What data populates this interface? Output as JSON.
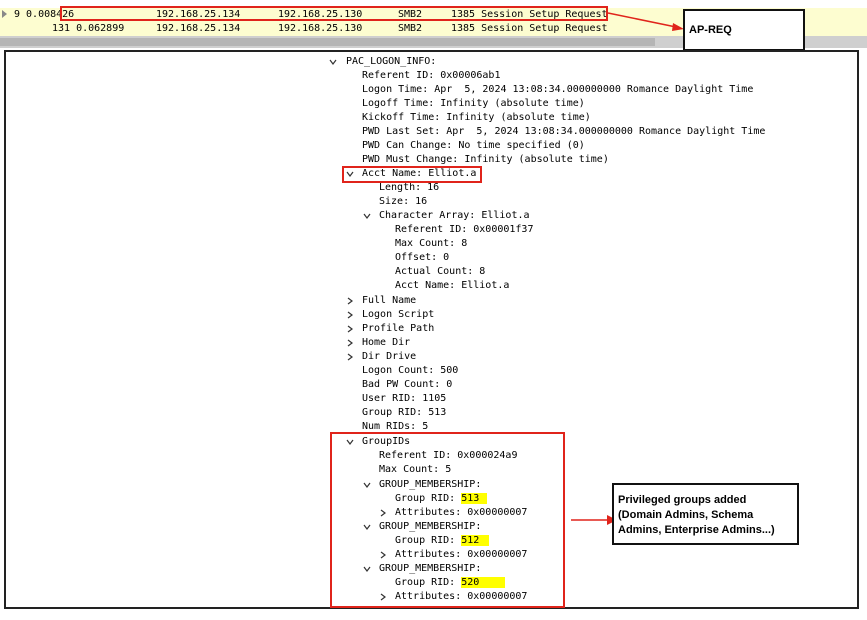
{
  "packet_list": {
    "rows": [
      {
        "no_time": "9 0.008426",
        "src": "192.168.25.134",
        "dst": "192.168.25.130",
        "proto": "SMB2",
        "info": "1385 Session Setup Request"
      },
      {
        "no_time": "131 0.062899",
        "src": "192.168.25.134",
        "dst": "192.168.25.130",
        "proto": "SMB2",
        "info": "1385 Session Setup Request"
      }
    ]
  },
  "tree": {
    "pac_logon_info": "PAC_LOGON_INFO:",
    "referent_id": "Referent ID: 0x00006ab1",
    "logon_time": "Logon Time: Apr  5, 2024 13:08:34.000000000 Romance Daylight Time",
    "logoff_time": "Logoff Time: Infinity (absolute time)",
    "kickoff_time": "Kickoff Time: Infinity (absolute time)",
    "pwd_last_set": "PWD Last Set: Apr  5, 2024 13:08:34.000000000 Romance Daylight Time",
    "pwd_can_change": "PWD Can Change: No time specified (0)",
    "pwd_must_change": "PWD Must Change: Infinity (absolute time)",
    "acct_name": "Acct Name: Elliot.a",
    "length": "Length: 16",
    "size": "Size: 16",
    "char_array": "Character Array: Elliot.a",
    "ca_referent_id": "Referent ID: 0x00001f37",
    "max_count": "Max Count: 8",
    "offset": "Offset: 0",
    "actual_count": "Actual Count: 8",
    "ca_acct_name": "Acct Name: Elliot.a",
    "full_name": "Full Name",
    "logon_script": "Logon Script",
    "profile_path": "Profile Path",
    "home_dir": "Home Dir",
    "dir_drive": "Dir Drive",
    "logon_count": "Logon Count: 500",
    "bad_pw_count": "Bad PW Count: 0",
    "user_rid": "User RID: 1105",
    "group_rid": "Group RID: 513",
    "num_rids": "Num RIDs: 5",
    "group_ids": "GroupIDs",
    "gid_referent_id": "Referent ID: 0x000024a9",
    "gid_max_count": "Max Count: 5",
    "group_membership": "GROUP_MEMBERSHIP:",
    "group_rid_label": "Group RID: ",
    "attributes": "Attributes: 0x00000007",
    "memberships": [
      {
        "rid": "513"
      },
      {
        "rid": "512"
      },
      {
        "rid": "520"
      }
    ]
  },
  "annotations": {
    "ap_req": "AP-REQ",
    "privileged_line1": "Privileged groups added",
    "privileged_line2": "(Domain Admins, Schema",
    "privileged_line3": "Admins, Enterprise Admins...)"
  },
  "colors": {
    "annotation_red": "#e0241b",
    "highlight_yellow": "#ffff00",
    "row_yellow": "#fdfdd0"
  }
}
